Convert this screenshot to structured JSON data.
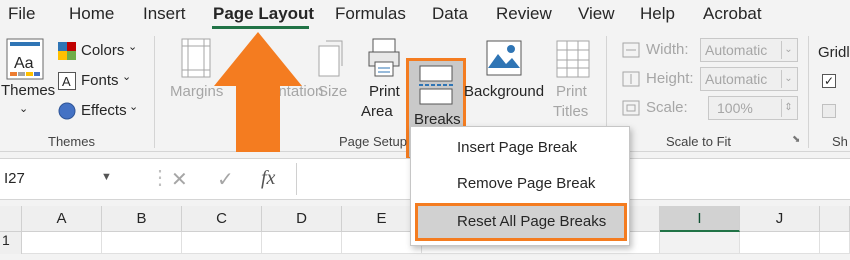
{
  "tabs": [
    "File",
    "Home",
    "Insert",
    "Page Layout",
    "Formulas",
    "Data",
    "Review",
    "View",
    "Help",
    "Acrobat"
  ],
  "themes_group": {
    "themes_label": "Themes",
    "colors_label": "Colors",
    "fonts_label": "Fonts",
    "effects_label": "Effects",
    "group_label": "Themes"
  },
  "page_setup": {
    "margins_label": "Margins",
    "orientation_label": "Orientation",
    "size_label": "Size",
    "print_area_label": [
      "Print",
      "Area"
    ],
    "breaks_label": "Breaks",
    "background_label": "Background",
    "print_titles_label": [
      "Print",
      "Titles"
    ],
    "group_label": "Page Setup"
  },
  "scale_to_fit": {
    "width_label": "Width:",
    "width_value": "Automatic",
    "height_label": "Height:",
    "height_value": "Automatic",
    "scale_label": "Scale:",
    "scale_value": "100%",
    "group_label": "Scale to Fit"
  },
  "sheet_options": {
    "gridlines_label": "Gridl",
    "group_label": "Sh"
  },
  "formula_bar": {
    "name_box": "I27",
    "fx": "fx"
  },
  "columns": [
    "A",
    "B",
    "C",
    "D",
    "E",
    "I",
    "J"
  ],
  "selected_column": "I",
  "rows": [
    "1"
  ],
  "breaks_menu": {
    "items": [
      "Insert Page Break",
      "Remove Page Break",
      "Reset All Page Breaks"
    ],
    "highlighted": "Reset All Page Breaks"
  },
  "colors": {
    "accent_orange": "#f47c20",
    "excel_green": "#217346"
  }
}
